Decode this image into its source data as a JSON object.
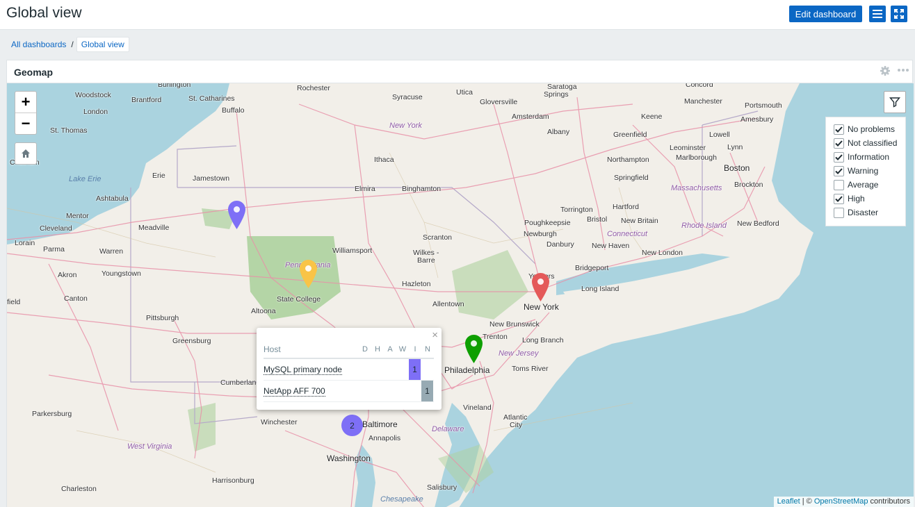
{
  "header": {
    "title": "Global view",
    "edit_label": "Edit dashboard"
  },
  "breadcrumb": {
    "all": "All dashboards",
    "sep": "/",
    "current": "Global view"
  },
  "widget": {
    "title": "Geomap"
  },
  "map": {
    "zoom_in": "+",
    "zoom_out": "−",
    "filters": [
      {
        "label": "No problems",
        "checked": true
      },
      {
        "label": "Not classified",
        "checked": true
      },
      {
        "label": "Information",
        "checked": true
      },
      {
        "label": "Warning",
        "checked": true
      },
      {
        "label": "Average",
        "checked": false
      },
      {
        "label": "High",
        "checked": true
      },
      {
        "label": "Disaster",
        "checked": false
      }
    ],
    "popup": {
      "close": "×",
      "col_host": "Host",
      "cols": [
        "D",
        "H",
        "A",
        "W",
        "I",
        "N"
      ],
      "rows": [
        {
          "host": "MySQL primary node",
          "count": "1",
          "color": "#7e6ff6"
        },
        {
          "host": "NetApp AFF 700",
          "count": "1",
          "color": "#97aab3"
        }
      ]
    },
    "cluster_count": "2",
    "markers": {
      "purple": "#7e6ff6",
      "yellow": "#f9c447",
      "red": "#e45959",
      "green": "#0e9f00"
    },
    "attribution": {
      "leaflet": "Leaflet",
      "sep": " | © ",
      "osm": "OpenStreetMap",
      "suffix": " contributors"
    },
    "labels": {
      "burlington": "Burlington",
      "rochester": "Rochester",
      "utica": "Utica",
      "saratoga": "Saratoga",
      "springs": "Springs",
      "concord": "Concord",
      "woodstock": "Woodstock",
      "brantford": "Brantford",
      "stcatharines": "St. Catharines",
      "buffalo": "Buffalo",
      "syracuse": "Syracuse",
      "gloversville": "Gloversville",
      "manchester": "Manchester",
      "portsmouth": "Portsmouth",
      "london": "London",
      "stthomas": "St. Thomas",
      "newyork_state": "New York",
      "amsterdam": "Amsterdam",
      "albany": "Albany",
      "keene": "Keene",
      "amesbury": "Amesbury",
      "chatham": "Chatham",
      "greenfield": "Greenfield",
      "leominster": "Leominster",
      "lowell": "Lowell",
      "lynn": "Lynn",
      "ithaca": "Ithaca",
      "erie": "Erie",
      "jamestown": "Jamestown",
      "northampton": "Northampton",
      "marlborough": "Marlborough",
      "boston": "Boston",
      "lakeerie": "Lake Erie",
      "elmira": "Elmira",
      "binghamton": "Binghamton",
      "springfield": "Springfield",
      "massachusetts": "Massachusetts",
      "brockton": "Brockton",
      "ashtabula": "Ashtabula",
      "torrington": "Torrington",
      "hartford": "Hartford",
      "mentor": "Mentor",
      "poughkeepsie": "Poughkeepsie",
      "bristol": "Bristol",
      "newbritain": "New Britain",
      "rhodeisland": "Rhode Island",
      "newbedford": "New Bedford",
      "cleveland": "Cleveland",
      "meadville": "Meadville",
      "newburgh": "Newburgh",
      "lorain": "Lorain",
      "parma": "Parma",
      "danbury": "Danbury",
      "connecticut": "Connecticut",
      "newhaven": "New Haven",
      "williamsport": "Williamsport",
      "scranton": "Scranton",
      "newlondon": "New London",
      "warren": "Warren",
      "wilkes": "Wilkes -",
      "barre": "Barre",
      "pennsylvania": "Pennsylvania",
      "bridgeport": "Bridgeport",
      "youngstown": "Youngstown",
      "akron": "Akron",
      "yonkers": "Yonkers",
      "hazleton": "Hazleton",
      "longisland": "Long Island",
      "canton": "Canton",
      "statecollege": "State College",
      "allentown": "Allentown",
      "newyork": "New York",
      "field": "field",
      "altoona": "Altoona",
      "pittsburgh": "Pittsburgh",
      "newbrunswick": "New Brunswick",
      "greensburg": "Greensburg",
      "trenton": "Trenton",
      "longbranch": "Long Branch",
      "newjersey": "New Jersey",
      "philadelphia": "Philadelphia",
      "tomsriver": "Toms River",
      "cumberland": "Cumberland",
      "parkersburg": "Parkersburg",
      "vineland": "Vineland",
      "atlantic": "Atlantic",
      "city": "City",
      "winchester": "Winchester",
      "baltimore": "Baltimore",
      "delaware": "Delaware",
      "annapolis": "Annapolis",
      "westvirginia": "West Virginia",
      "washington": "Washington",
      "harrisonburg": "Harrisonburg",
      "charleston": "Charleston",
      "salisbury": "Salisbury",
      "chesapeake": "Chesapeake"
    }
  }
}
